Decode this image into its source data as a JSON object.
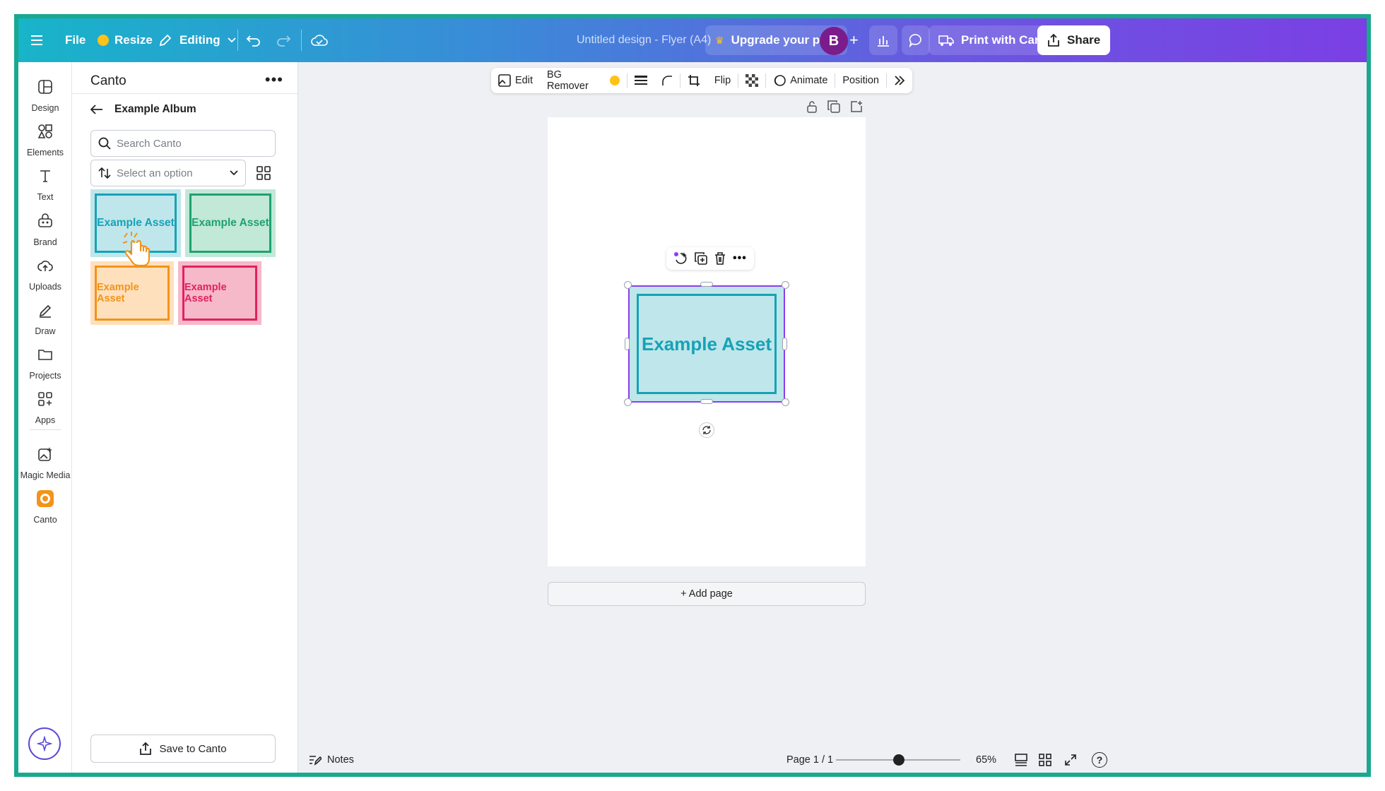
{
  "topbar": {
    "file": "File",
    "resize": "Resize",
    "mode": "Editing",
    "doc_title": "Untitled design - Flyer (A4)",
    "upgrade": "Upgrade your plan",
    "avatar_initial": "B",
    "print": "Print with Canva",
    "share": "Share"
  },
  "rail": {
    "items": [
      {
        "label": "Design"
      },
      {
        "label": "Elements"
      },
      {
        "label": "Text"
      },
      {
        "label": "Brand"
      },
      {
        "label": "Uploads"
      },
      {
        "label": "Draw"
      },
      {
        "label": "Projects"
      },
      {
        "label": "Apps"
      },
      {
        "label": "Magic Media"
      },
      {
        "label": "Canto"
      }
    ]
  },
  "panel": {
    "title": "Canto",
    "more": "•••",
    "album": "Example Album",
    "search_placeholder": "Search Canto",
    "sort_placeholder": "Select an option",
    "assets": [
      {
        "label": "Example Asset",
        "bg": "#bfe6ea",
        "border": "#16a2b7",
        "text": "#16a2b7"
      },
      {
        "label": "Example Asset",
        "bg": "#c2e8d7",
        "border": "#1ea36f",
        "text": "#1ea36f"
      },
      {
        "label": "Example Asset",
        "bg": "#ffe0bd",
        "border": "#f39319",
        "text": "#f39319"
      },
      {
        "label": "Example Asset",
        "bg": "#f6b9c9",
        "border": "#e0225f",
        "text": "#e0225f"
      }
    ],
    "save": "Save to Canto"
  },
  "toolbar": {
    "edit": "Edit",
    "bg_remover": "BG Remover",
    "flip": "Flip",
    "animate": "Animate",
    "position": "Position"
  },
  "canvas": {
    "selected_asset": "Example Asset",
    "add_page": "+ Add page"
  },
  "bottom": {
    "notes": "Notes",
    "page": "Page 1 / 1",
    "zoom": "65%",
    "zoom_value": 0.65
  },
  "colors": {
    "accent": "#8b3df0",
    "frame": "#1aa88f"
  }
}
